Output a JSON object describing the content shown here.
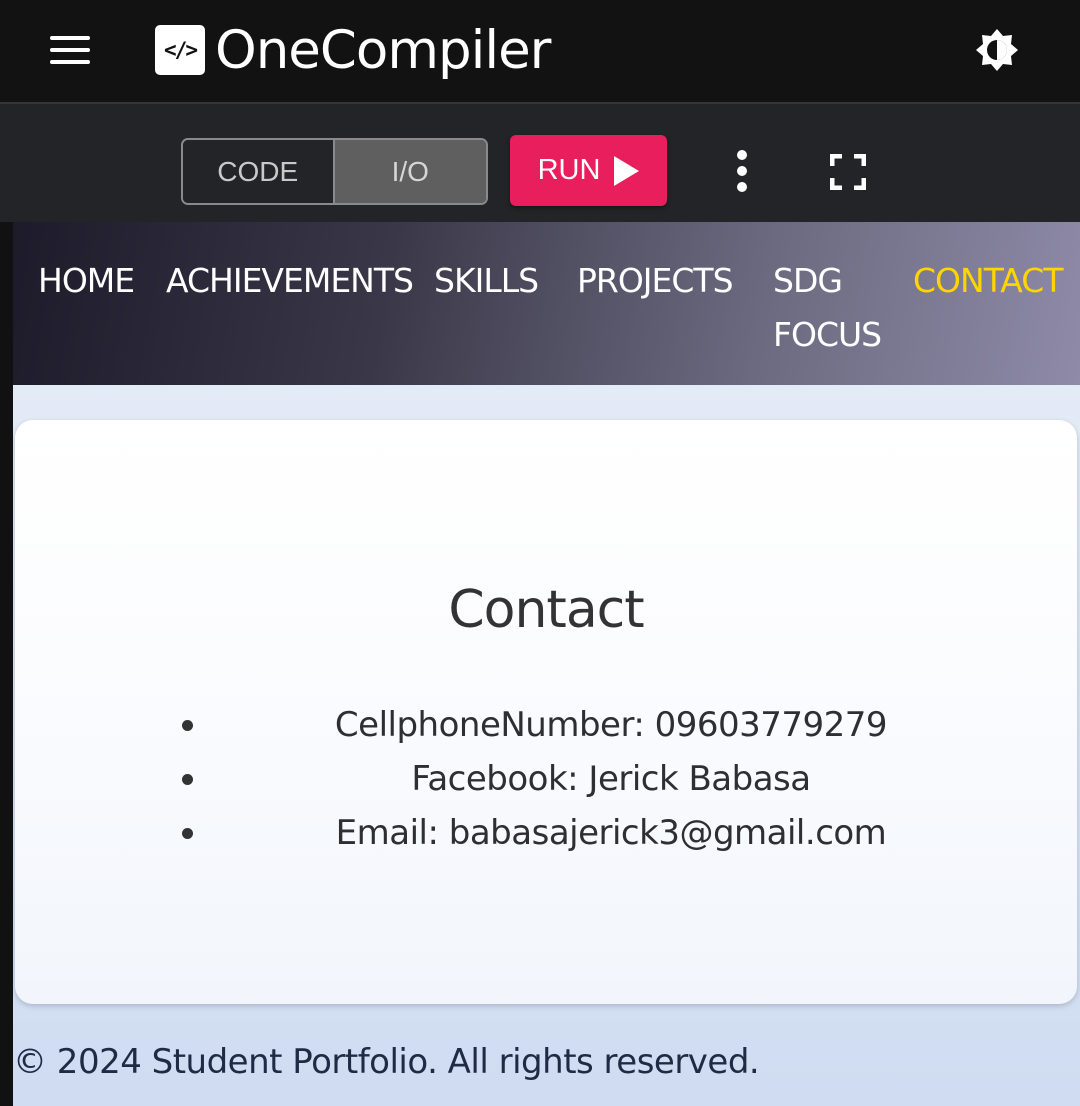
{
  "app": {
    "logo_glyph": "</>",
    "title": "OneCompiler"
  },
  "toolbar": {
    "code_tab": "CODE",
    "io_tab": "I/O",
    "run_label": "RUN"
  },
  "preview": {
    "nav": {
      "items": [
        {
          "label": "HOME"
        },
        {
          "label": "ACHIEVEMENTS"
        },
        {
          "label": "SKILLS"
        },
        {
          "label": "PROJECTS"
        },
        {
          "label": "SDG FOCUS"
        },
        {
          "label": "CONTACT"
        }
      ],
      "active": "CONTACT"
    },
    "contact": {
      "title": "Contact",
      "items": [
        "CellphoneNumber: 09603779279",
        "Facebook: Jerick Babasa",
        "Email: babasajerick3@gmail.com"
      ]
    },
    "footer": "© 2024 Student Portfolio. All rights reserved."
  },
  "colors": {
    "run_button": "#e91e5c",
    "active_nav": "#ffd400",
    "topbar": "#121212",
    "toolbar": "#232427"
  },
  "icons": [
    "hamburger-menu-icon",
    "code-logo-icon",
    "theme-toggle-icon",
    "play-icon",
    "more-vert-icon",
    "fullscreen-icon"
  ]
}
